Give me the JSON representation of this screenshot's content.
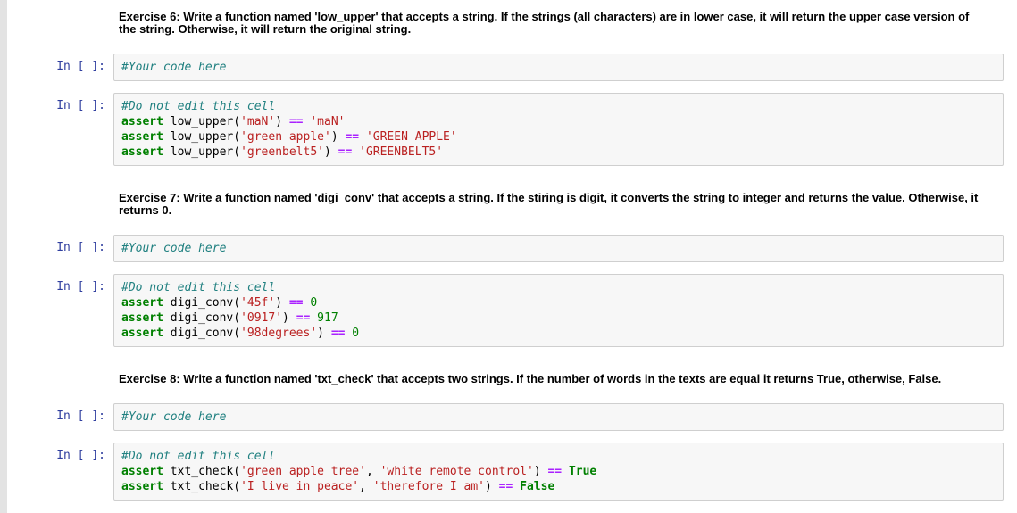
{
  "page": {
    "background": "#ffffff",
    "left_strip_color": "#e3e3e3"
  },
  "colors": {
    "prompt": "#303F9F",
    "cell_background": "#f7f7f7",
    "cell_border": "#cfcfcf",
    "comment": "#208080",
    "keyword": "#008000",
    "string": "#BA2121",
    "operator": "#AA22FF",
    "number": "#008000",
    "plain": "#000000"
  },
  "prompt_label": "In [ ]:",
  "cells": [
    {
      "type": "markdown",
      "name": "exercise-6-instructions",
      "text": "Exercise 6: Write a function named 'low_upper' that accepts a string. If the strings (all characters) are in lower case, it will return the upper case version of the string. Otherwise, it will return the original string."
    },
    {
      "type": "code",
      "name": "exercise-6-answer-cell",
      "lines": [
        [
          {
            "t": "comment",
            "v": "#Your code here"
          }
        ]
      ]
    },
    {
      "type": "code",
      "name": "exercise-6-test-cell",
      "lines": [
        [
          {
            "t": "comment",
            "v": "#Do not edit this cell"
          }
        ],
        [
          {
            "t": "keyword",
            "v": "assert"
          },
          {
            "t": "plain",
            "v": " low_upper("
          },
          {
            "t": "string",
            "v": "'maN'"
          },
          {
            "t": "plain",
            "v": ") "
          },
          {
            "t": "operator",
            "v": "=="
          },
          {
            "t": "plain",
            "v": " "
          },
          {
            "t": "string",
            "v": "'maN'"
          }
        ],
        [
          {
            "t": "keyword",
            "v": "assert"
          },
          {
            "t": "plain",
            "v": " low_upper("
          },
          {
            "t": "string",
            "v": "'green apple'"
          },
          {
            "t": "plain",
            "v": ") "
          },
          {
            "t": "operator",
            "v": "=="
          },
          {
            "t": "plain",
            "v": " "
          },
          {
            "t": "string",
            "v": "'GREEN APPLE'"
          }
        ],
        [
          {
            "t": "keyword",
            "v": "assert"
          },
          {
            "t": "plain",
            "v": " low_upper("
          },
          {
            "t": "string",
            "v": "'greenbelt5'"
          },
          {
            "t": "plain",
            "v": ") "
          },
          {
            "t": "operator",
            "v": "=="
          },
          {
            "t": "plain",
            "v": " "
          },
          {
            "t": "string",
            "v": "'GREENBELT5'"
          }
        ]
      ]
    },
    {
      "type": "markdown",
      "name": "exercise-7-instructions",
      "text": "Exercise 7: Write a function named 'digi_conv' that accepts a string. If the stiring is digit, it converts the string to integer and returns the value. Otherwise, it returns 0."
    },
    {
      "type": "code",
      "name": "exercise-7-answer-cell",
      "lines": [
        [
          {
            "t": "comment",
            "v": "#Your code here"
          }
        ]
      ]
    },
    {
      "type": "code",
      "name": "exercise-7-test-cell",
      "lines": [
        [
          {
            "t": "comment",
            "v": "#Do not edit this cell"
          }
        ],
        [
          {
            "t": "keyword",
            "v": "assert"
          },
          {
            "t": "plain",
            "v": " digi_conv("
          },
          {
            "t": "string",
            "v": "'45f'"
          },
          {
            "t": "plain",
            "v": ") "
          },
          {
            "t": "operator",
            "v": "=="
          },
          {
            "t": "plain",
            "v": " "
          },
          {
            "t": "number",
            "v": "0"
          }
        ],
        [
          {
            "t": "keyword",
            "v": "assert"
          },
          {
            "t": "plain",
            "v": " digi_conv("
          },
          {
            "t": "string",
            "v": "'0917'"
          },
          {
            "t": "plain",
            "v": ") "
          },
          {
            "t": "operator",
            "v": "=="
          },
          {
            "t": "plain",
            "v": " "
          },
          {
            "t": "number",
            "v": "917"
          }
        ],
        [
          {
            "t": "keyword",
            "v": "assert"
          },
          {
            "t": "plain",
            "v": " digi_conv("
          },
          {
            "t": "string",
            "v": "'98degrees'"
          },
          {
            "t": "plain",
            "v": ") "
          },
          {
            "t": "operator",
            "v": "=="
          },
          {
            "t": "plain",
            "v": " "
          },
          {
            "t": "number",
            "v": "0"
          }
        ]
      ]
    },
    {
      "type": "markdown",
      "name": "exercise-8-instructions",
      "text": "Exercise 8: Write a function named 'txt_check' that accepts two strings. If the number of words in the texts are equal it returns True, otherwise, False."
    },
    {
      "type": "code",
      "name": "exercise-8-answer-cell",
      "lines": [
        [
          {
            "t": "comment",
            "v": "#Your code here"
          }
        ]
      ]
    },
    {
      "type": "code",
      "name": "exercise-8-test-cell",
      "lines": [
        [
          {
            "t": "comment",
            "v": "#Do not edit this cell"
          }
        ],
        [
          {
            "t": "keyword",
            "v": "assert"
          },
          {
            "t": "plain",
            "v": " txt_check("
          },
          {
            "t": "string",
            "v": "'green apple tree'"
          },
          {
            "t": "plain",
            "v": ", "
          },
          {
            "t": "string",
            "v": "'white remote control'"
          },
          {
            "t": "plain",
            "v": ") "
          },
          {
            "t": "operator",
            "v": "=="
          },
          {
            "t": "plain",
            "v": " "
          },
          {
            "t": "keyword",
            "v": "True"
          }
        ],
        [
          {
            "t": "keyword",
            "v": "assert"
          },
          {
            "t": "plain",
            "v": " txt_check("
          },
          {
            "t": "string",
            "v": "'I live in peace'"
          },
          {
            "t": "plain",
            "v": ", "
          },
          {
            "t": "string",
            "v": "'therefore I am'"
          },
          {
            "t": "plain",
            "v": ") "
          },
          {
            "t": "operator",
            "v": "=="
          },
          {
            "t": "plain",
            "v": " "
          },
          {
            "t": "keyword",
            "v": "False"
          }
        ]
      ]
    }
  ]
}
